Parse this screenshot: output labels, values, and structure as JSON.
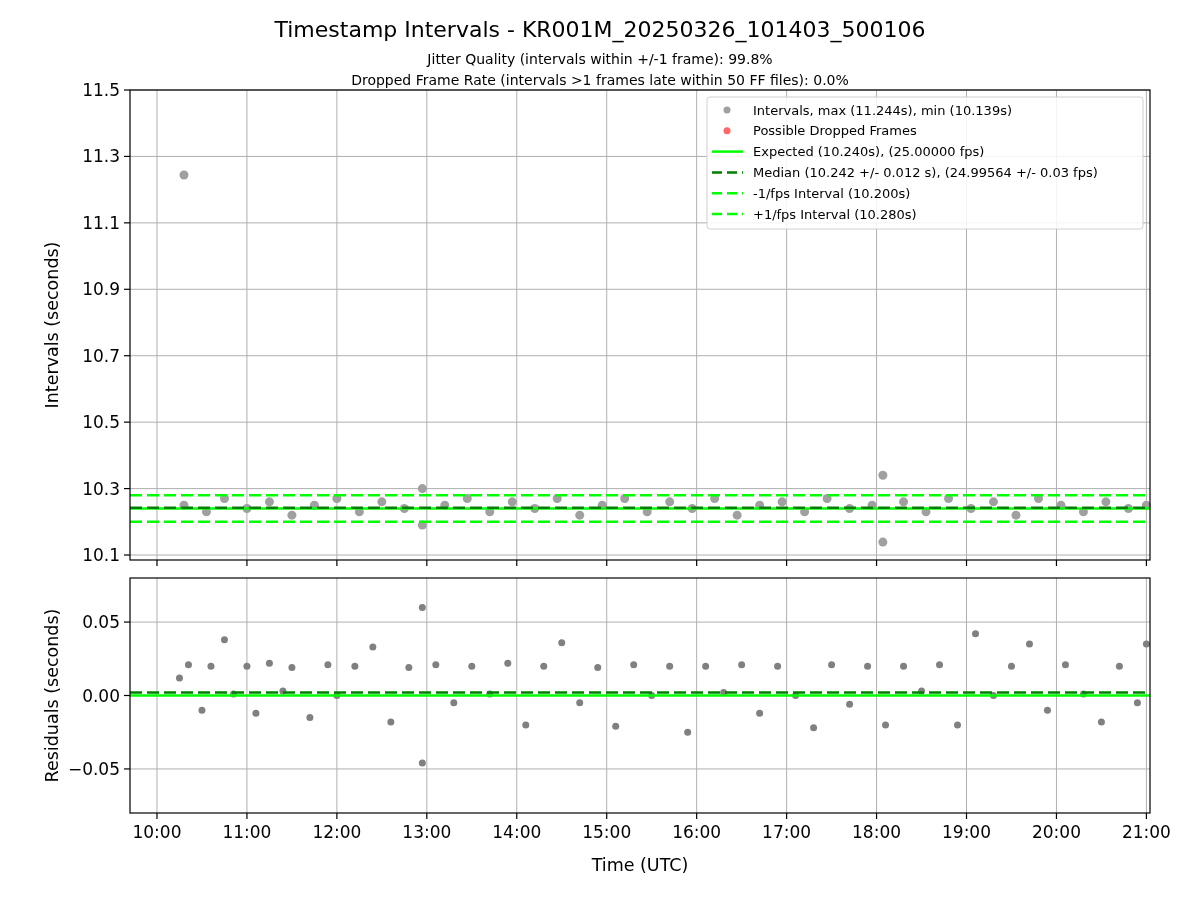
{
  "title": "Timestamp Intervals - KR001M_20250326_101403_500106",
  "subtitles": [
    "Jitter Quality (intervals within +/-1 frame): 99.8%",
    "Dropped Frame Rate (intervals >1 frames late within 50 FF files): 0.0%"
  ],
  "intervals_chart": {
    "chart_data": {
      "type": "scatter",
      "ylabel": "Intervals (seconds)",
      "xlim": [
        9.7,
        21.04
      ],
      "ylim": [
        10.085,
        11.5
      ],
      "yticks": [
        {
          "value": 10.1,
          "label": "10.1"
        },
        {
          "value": 10.3,
          "label": "10.3"
        },
        {
          "value": 10.5,
          "label": "10.5"
        },
        {
          "value": 10.7,
          "label": "10.7"
        },
        {
          "value": 10.9,
          "label": "10.9"
        },
        {
          "value": 11.1,
          "label": "11.1"
        },
        {
          "value": 11.3,
          "label": "11.3"
        },
        {
          "value": 11.5,
          "label": "11.5"
        }
      ],
      "series": [
        {
          "name": "Intervals, max (11.244s), min (10.139s)",
          "color": "#a0a0a0",
          "x": [
            10.3,
            10.3,
            10.55,
            10.75,
            11.0,
            11.25,
            11.5,
            11.75,
            12.0,
            12.25,
            12.5,
            12.75,
            12.95,
            12.95,
            13.2,
            13.45,
            13.7,
            13.95,
            14.2,
            14.45,
            14.7,
            14.95,
            15.2,
            15.45,
            15.7,
            15.95,
            16.2,
            16.45,
            16.7,
            16.95,
            17.2,
            17.45,
            17.7,
            17.95,
            18.07,
            18.07,
            18.3,
            18.55,
            18.8,
            19.05,
            19.3,
            19.55,
            19.8,
            20.05,
            20.3,
            20.55,
            20.8,
            21.0
          ],
          "values": [
            11.244,
            10.25,
            10.23,
            10.27,
            10.24,
            10.26,
            10.22,
            10.25,
            10.27,
            10.23,
            10.26,
            10.24,
            10.3,
            10.19,
            10.25,
            10.27,
            10.23,
            10.26,
            10.24,
            10.27,
            10.22,
            10.25,
            10.27,
            10.23,
            10.26,
            10.24,
            10.27,
            10.22,
            10.25,
            10.26,
            10.23,
            10.27,
            10.24,
            10.25,
            10.34,
            10.139,
            10.26,
            10.23,
            10.27,
            10.24,
            10.26,
            10.22,
            10.27,
            10.25,
            10.23,
            10.26,
            10.24,
            10.25
          ]
        },
        {
          "name": "Possible Dropped Frames",
          "color": "#ff6666"
        }
      ],
      "ref_lines": [
        {
          "axis": "y",
          "value": 10.24,
          "label": "Expected (10.240s), (25.00000 fps)",
          "color": "#00ff00"
        },
        {
          "axis": "y",
          "value": 10.242,
          "label": "Median (10.242 +/- 0.012 s), (24.99564 +/- 0.03 fps)",
          "color": "#008000"
        },
        {
          "axis": "y",
          "value": 10.2,
          "label": "-1/fps Interval (10.200s)",
          "color": "#00ff00"
        },
        {
          "axis": "y",
          "value": 10.28,
          "label": "+1/fps Interval (10.280s)",
          "color": "#00ff00"
        }
      ],
      "grid": true,
      "legend": true
    }
  },
  "residuals_chart": {
    "chart_data": {
      "type": "scatter",
      "xlabel": "Time (UTC)",
      "ylabel": "Residuals (seconds)",
      "xlim": [
        9.7,
        21.04
      ],
      "ylim": [
        -0.08,
        0.08
      ],
      "xticks": [
        {
          "value": 10,
          "label": "10:00"
        },
        {
          "value": 11,
          "label": "11:00"
        },
        {
          "value": 12,
          "label": "12:00"
        },
        {
          "value": 13,
          "label": "13:00"
        },
        {
          "value": 14,
          "label": "14:00"
        },
        {
          "value": 15,
          "label": "15:00"
        },
        {
          "value": 16,
          "label": "16:00"
        },
        {
          "value": 17,
          "label": "17:00"
        },
        {
          "value": 18,
          "label": "18:00"
        },
        {
          "value": 19,
          "label": "19:00"
        },
        {
          "value": 20,
          "label": "20:00"
        },
        {
          "value": 21,
          "label": "21:00"
        }
      ],
      "yticks": [
        {
          "value": -0.05,
          "label": "−0.05"
        },
        {
          "value": 0,
          "label": "0.00"
        },
        {
          "value": 0.05,
          "label": "0.05"
        }
      ],
      "series": [
        {
          "color": "#808080",
          "x": [
            10.25,
            10.35,
            10.5,
            10.6,
            10.75,
            10.85,
            11.0,
            11.1,
            11.25,
            11.4,
            11.5,
            11.7,
            11.9,
            12.0,
            12.2,
            12.4,
            12.6,
            12.8,
            12.95,
            12.95,
            13.1,
            13.3,
            13.5,
            13.7,
            13.9,
            14.1,
            14.3,
            14.5,
            14.7,
            14.9,
            15.1,
            15.3,
            15.5,
            15.7,
            15.9,
            16.1,
            16.3,
            16.5,
            16.7,
            16.9,
            17.1,
            17.3,
            17.5,
            17.7,
            17.9,
            18.1,
            18.3,
            18.5,
            18.7,
            18.9,
            19.1,
            19.3,
            19.5,
            19.7,
            19.9,
            20.1,
            20.3,
            20.5,
            20.7,
            20.9,
            21.0
          ],
          "values": [
            0.012,
            0.021,
            -0.01,
            0.02,
            0.038,
            0.001,
            0.02,
            -0.012,
            0.022,
            0.003,
            0.019,
            -0.015,
            0.021,
            0.0,
            0.02,
            0.033,
            -0.018,
            0.019,
            0.06,
            -0.046,
            0.021,
            -0.005,
            0.02,
            0.001,
            0.022,
            -0.02,
            0.02,
            0.036,
            -0.005,
            0.019,
            -0.021,
            0.021,
            0.0,
            0.02,
            -0.025,
            0.02,
            0.002,
            0.021,
            -0.012,
            0.02,
            0.0,
            -0.022,
            0.021,
            -0.006,
            0.02,
            -0.02,
            0.02,
            0.003,
            0.021,
            -0.02,
            0.042,
            0.0,
            0.02,
            0.035,
            -0.01,
            0.021,
            0.001,
            -0.018,
            0.02,
            -0.005,
            0.035
          ]
        }
      ],
      "ref_lines": [
        {
          "axis": "y",
          "value": 0,
          "color": "#00ff00"
        },
        {
          "axis": "y",
          "value": 0.002,
          "color": "#008000"
        }
      ],
      "grid": true
    }
  }
}
